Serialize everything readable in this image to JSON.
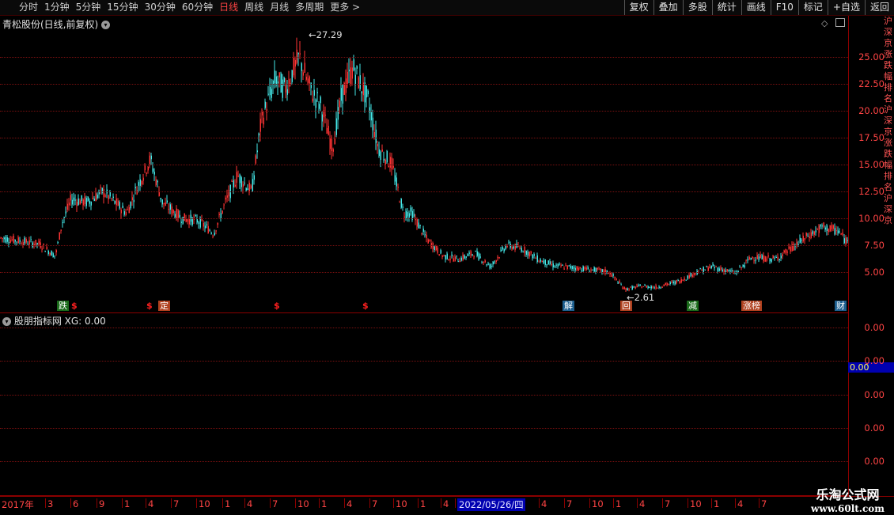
{
  "toolbar": {
    "periods": [
      "分时",
      "1分钟",
      "5分钟",
      "15分钟",
      "30分钟",
      "60分钟",
      "日线",
      "周线",
      "月线",
      "多周期",
      "更多 >"
    ],
    "active_period": "日线",
    "tools": [
      "复权",
      "叠加",
      "多股",
      "统计",
      "画线",
      "F10",
      "标记",
      "+自选",
      "返回"
    ]
  },
  "main_chart": {
    "title": "青松股份(日线,前复权)",
    "high_marker": "27.29",
    "low_marker": "2.61",
    "price_labels": [
      "25.00",
      "22.50",
      "20.00",
      "17.50",
      "15.00",
      "12.50",
      "10.00",
      "7.50",
      "5.00"
    ],
    "events": [
      {
        "text": "跌",
        "style": "green"
      },
      {
        "text": "$",
        "style": "dollar"
      },
      {
        "text": "$",
        "style": "dollar"
      },
      {
        "text": "定",
        "style": "orange"
      },
      {
        "text": "$",
        "style": "dollar"
      },
      {
        "text": "$",
        "style": "dollar"
      },
      {
        "text": "解",
        "style": "blue"
      },
      {
        "text": "回",
        "style": "orange"
      },
      {
        "text": "减",
        "style": "green"
      },
      {
        "text": "涨榜",
        "style": "orange"
      },
      {
        "text": "财",
        "style": "blue"
      }
    ],
    "colors": {
      "up": "#ff3333",
      "down": "#44e8e8"
    }
  },
  "sub_chart": {
    "title": "股朋指标网 XG: 0.00",
    "labels": [
      "0.00",
      "0.00",
      "0.00",
      "0.00",
      "0.00"
    ],
    "highlight_value": "0.00"
  },
  "time_axis": {
    "ticks": [
      "2017年",
      "3",
      "6",
      "9",
      "1",
      "4",
      "7",
      "10",
      "1",
      "4",
      "7",
      "10",
      "1",
      "4",
      "7",
      "10",
      "1",
      "4",
      "2022/05/26/四",
      "4",
      "7",
      "10",
      "1",
      "4",
      "7",
      "10",
      "1",
      "4",
      "7"
    ],
    "highlight_date": "2022/05/26/四"
  },
  "watermark": {
    "line1": "乐淘公式网",
    "line2": "www.60lt.com"
  },
  "right_strip_text": "沪深京涨跌幅排名沪深京涨跌幅排名沪深京"
}
